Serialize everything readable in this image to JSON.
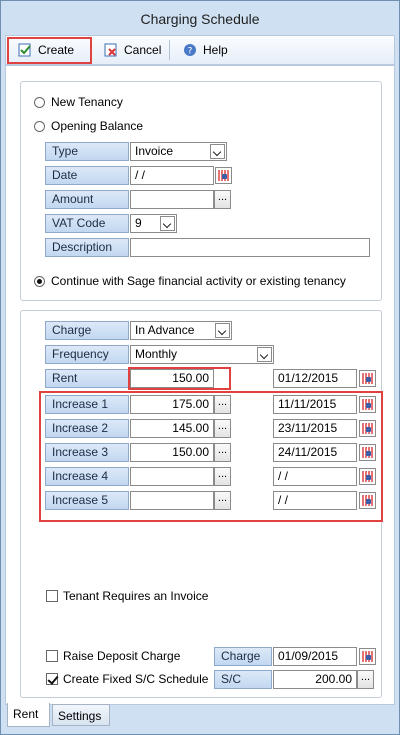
{
  "window": {
    "title": "Charging Schedule"
  },
  "toolbar": {
    "create_label": "Create",
    "cancel_label": "Cancel",
    "help_label": "Help"
  },
  "options": {
    "new_tenancy": "New Tenancy",
    "opening_balance": "Opening Balance",
    "continue_label": "Continue with Sage financial activity or existing tenancy",
    "selected": "continue"
  },
  "opening": {
    "type_label": "Type",
    "type_value": "Invoice",
    "date_label": "Date",
    "date_value": " /  /",
    "amount_label": "Amount",
    "amount_value": "",
    "vat_label": "VAT Code",
    "vat_value": "9",
    "description_label": "Description",
    "description_value": ""
  },
  "schedule": {
    "charge_label": "Charge",
    "charge_value": "In Advance",
    "frequency_label": "Frequency",
    "frequency_value": "Monthly",
    "rent_label": "Rent",
    "rent_value": "150.00",
    "rent_date": "01/12/2015",
    "increases": [
      {
        "label": "Increase 1",
        "amount": "175.00",
        "date": "11/11/2015"
      },
      {
        "label": "Increase 2",
        "amount": "145.00",
        "date": "23/11/2015"
      },
      {
        "label": "Increase 3",
        "amount": "150.00",
        "date": "24/11/2015"
      },
      {
        "label": "Increase 4",
        "amount": "",
        "date": " /  /"
      },
      {
        "label": "Increase 5",
        "amount": "",
        "date": " /  /"
      }
    ],
    "tenant_invoice_label": "Tenant Requires an Invoice",
    "deposit_label": "Raise Deposit Charge",
    "deposit_charge_label": "Charge",
    "deposit_charge_date": "01/09/2015",
    "fixed_sc_label": "Create Fixed S/C Schedule",
    "sc_label": "S/C",
    "sc_value": "200.00"
  },
  "tabs": [
    "Rent",
    "Settings"
  ],
  "colors": {
    "highlight": "#e0433f",
    "label_bg": "#c2d7f0",
    "window_bg": "#cfe0f3"
  }
}
